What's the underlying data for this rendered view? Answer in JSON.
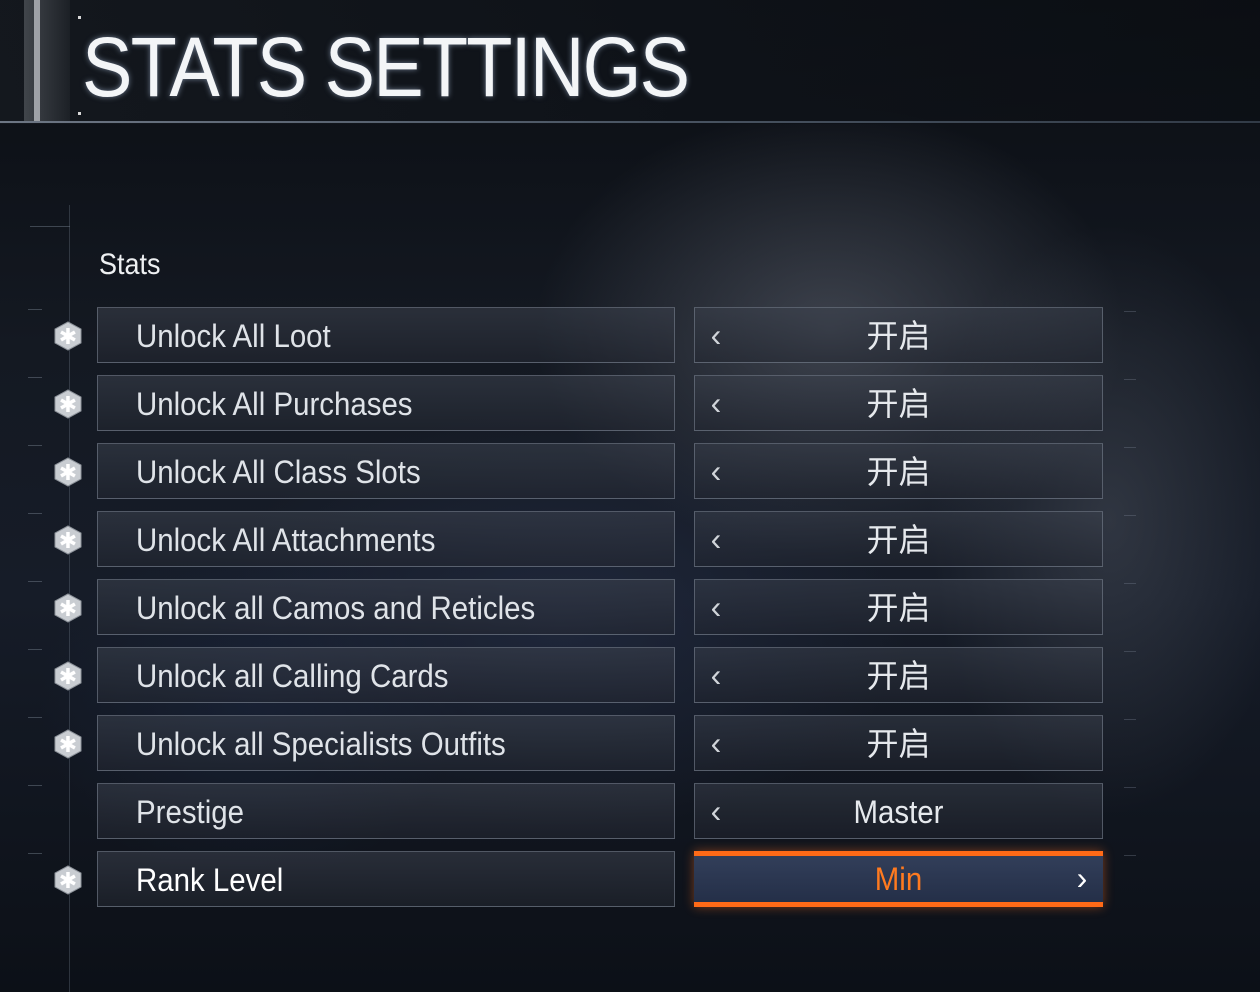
{
  "header": {
    "title": "STATS SETTINGS"
  },
  "section": {
    "label": "Stats"
  },
  "rows": [
    {
      "label": "Unlock All Loot",
      "value": "开启",
      "has_icon": true,
      "left_arrow": true,
      "right_arrow": false,
      "selected": false
    },
    {
      "label": "Unlock All Purchases",
      "value": "开启",
      "has_icon": true,
      "left_arrow": true,
      "right_arrow": false,
      "selected": false
    },
    {
      "label": "Unlock All Class Slots",
      "value": "开启",
      "has_icon": true,
      "left_arrow": true,
      "right_arrow": false,
      "selected": false
    },
    {
      "label": "Unlock All Attachments",
      "value": "开启",
      "has_icon": true,
      "left_arrow": true,
      "right_arrow": false,
      "selected": false
    },
    {
      "label": "Unlock all Camos and Reticles",
      "value": "开启",
      "has_icon": true,
      "left_arrow": true,
      "right_arrow": false,
      "selected": false
    },
    {
      "label": "Unlock all Calling Cards",
      "value": "开启",
      "has_icon": true,
      "left_arrow": true,
      "right_arrow": false,
      "selected": false
    },
    {
      "label": "Unlock all Specialists Outfits",
      "value": "开启",
      "has_icon": true,
      "left_arrow": true,
      "right_arrow": false,
      "selected": false
    },
    {
      "label": "Prestige",
      "value": "Master",
      "has_icon": false,
      "left_arrow": true,
      "right_arrow": false,
      "selected": false
    },
    {
      "label": "Rank Level",
      "value": "Min",
      "has_icon": true,
      "left_arrow": false,
      "right_arrow": true,
      "selected": true
    }
  ],
  "icons": {
    "row_icon": "asterisk-hexagon-icon",
    "left_arrow": "chevron-left-icon",
    "right_arrow": "chevron-right-icon"
  },
  "colors": {
    "accent": "#ff6a17",
    "selected_value": "#ff7a1f",
    "text": "#dfe3e8"
  }
}
